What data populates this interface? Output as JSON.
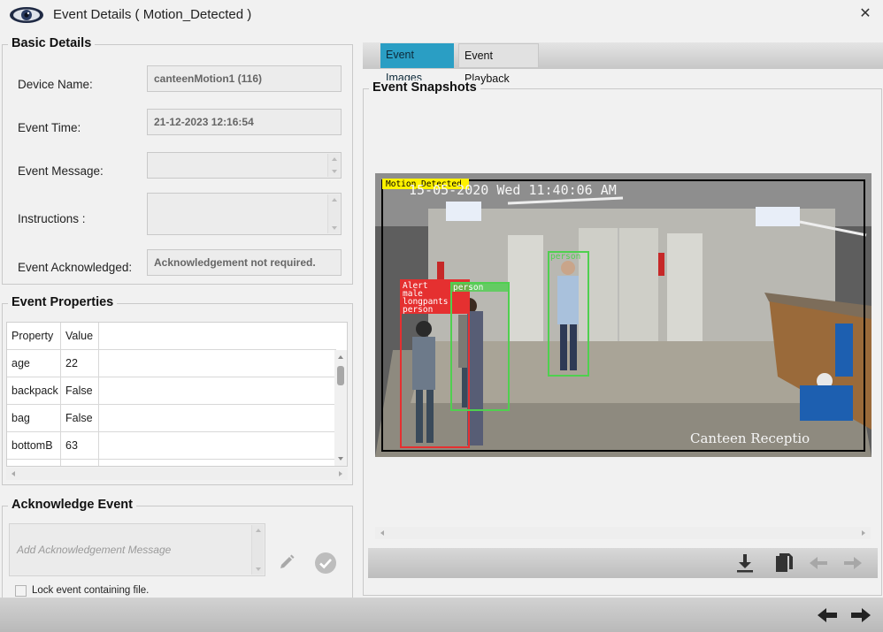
{
  "window": {
    "title": "Event Details ( Motion_Detected )",
    "close_label": "✕",
    "app_icon": "eye-icon"
  },
  "basic_details": {
    "title": "Basic Details",
    "device_name_label": "Device Name:",
    "device_name_value": "canteenMotion1 (116)",
    "event_time_label": "Event Time:",
    "event_time_value": "21-12-2023 12:16:54",
    "event_message_label": "Event Message:",
    "event_message_value": "",
    "instructions_label": "Instructions :",
    "instructions_value": "",
    "event_ack_label": "Event Acknowledged:",
    "event_ack_value": "Acknowledgement not required."
  },
  "event_properties": {
    "title": "Event Properties",
    "columns": [
      "Property",
      "Value"
    ],
    "rows": [
      {
        "property": "age",
        "value": "22"
      },
      {
        "property": "backpack",
        "value": "False"
      },
      {
        "property": "bag",
        "value": "False"
      },
      {
        "property": "bottomB",
        "value": "63"
      }
    ]
  },
  "acknowledge_event": {
    "title": "Acknowledge Event",
    "message_placeholder": "Add Acknowledgement Message",
    "lock_label": "Lock event containing file.",
    "lock_checked": false
  },
  "tabs": [
    {
      "label": "Event Images",
      "active": true
    },
    {
      "label": "Event Playback",
      "active": false
    }
  ],
  "snapshots": {
    "title": "Event Snapshots",
    "overlay_tag": "Motion_Detected",
    "overlay_timestamp": "15-05-2020 Wed 11:40:06 AM",
    "camera_label": "Canteen Receptio",
    "detection_labels": [
      "Alert",
      "male",
      "longpants",
      "person"
    ],
    "person_label": "person"
  },
  "colors": {
    "accent_tab": "#2a9ec4",
    "bbox_red": "#e53030",
    "bbox_green": "#4fd04f",
    "overlay_yellow": "#fff200"
  }
}
